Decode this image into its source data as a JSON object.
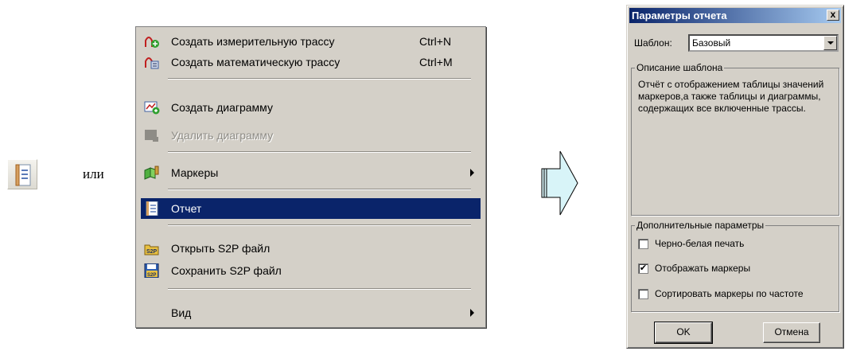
{
  "or_text": "или",
  "menu": {
    "items": [
      {
        "label": "Создать измерительную трассу",
        "shortcut": "Ctrl+N",
        "icon": "measurement-trace-icon"
      },
      {
        "label": "Создать математическую трассу",
        "shortcut": "Ctrl+M",
        "icon": "math-trace-icon"
      },
      {
        "label": "Создать диаграмму",
        "icon": "create-chart-icon"
      },
      {
        "label": "Удалить диаграмму",
        "icon": "delete-chart-icon",
        "disabled": true
      },
      {
        "label": "Маркеры",
        "icon": "markers-icon",
        "submenu": true
      },
      {
        "label": "Отчет",
        "icon": "report-icon",
        "selected": true
      },
      {
        "label": "Открыть S2P файл",
        "icon": "open-s2p-icon"
      },
      {
        "label": "Сохранить S2P файл",
        "icon": "save-s2p-icon"
      },
      {
        "label": "Вид",
        "submenu": true
      }
    ]
  },
  "dialog": {
    "title": "Параметры отчета",
    "close": "x",
    "template_label": "Шаблон:",
    "template_value": "Базовый",
    "description_legend": "Описание шаблона",
    "description_text": "Отчёт с отображением таблицы значений маркеров,а также таблицы и диаграммы, содержащих все включенные трассы.",
    "extra_legend": "Дополнительные параметры",
    "options": [
      {
        "label": "Черно-белая печать",
        "checked": false
      },
      {
        "label": "Отображать маркеры",
        "checked": true
      },
      {
        "label": "Сортировать маркеры по частоте",
        "checked": false
      }
    ],
    "ok_label": "OK",
    "cancel_label": "Отмена"
  },
  "colors": {
    "selection": "#0a246a",
    "window": "#d4d0c8",
    "arrow_fill": "#d8f4f8"
  }
}
